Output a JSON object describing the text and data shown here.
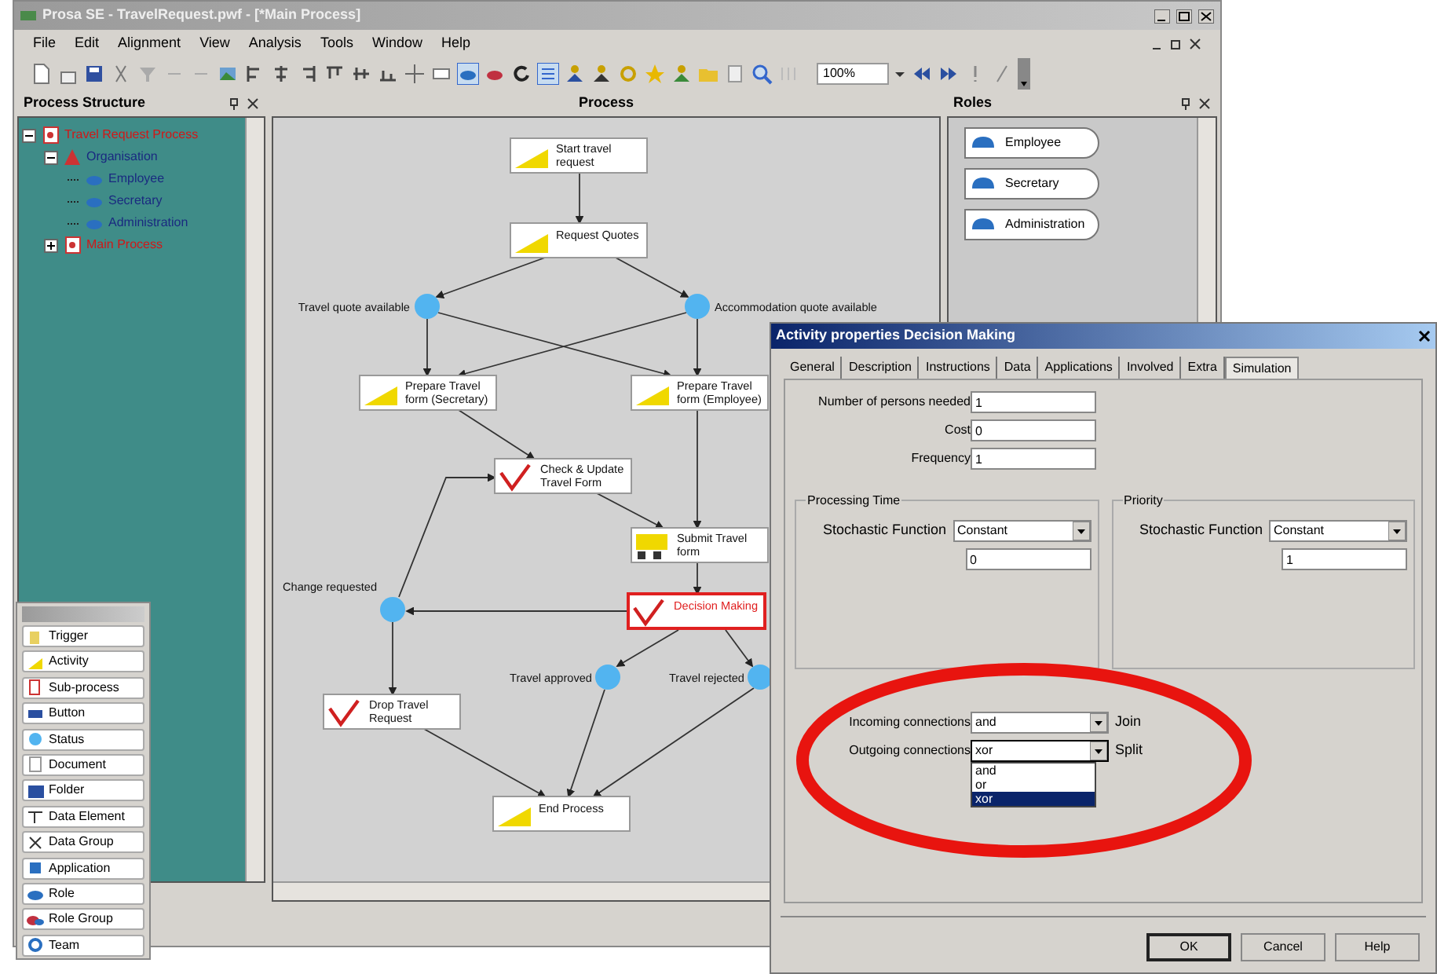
{
  "window": {
    "title": "Prosa SE - TravelRequest.pwf - [*Main Process]"
  },
  "menu": [
    "File",
    "Edit",
    "Alignment",
    "View",
    "Analysis",
    "Tools",
    "Window",
    "Help"
  ],
  "toolbar": {
    "zoom": "100%"
  },
  "structure": {
    "title": "Process Structure",
    "tree": [
      {
        "label": "Travel Request Process",
        "kind": "process",
        "expanded": true,
        "children": [
          {
            "label": "Organisation",
            "kind": "organisation",
            "expanded": true,
            "children": [
              {
                "label": "Employee",
                "kind": "role"
              },
              {
                "label": "Secretary",
                "kind": "role"
              },
              {
                "label": "Administration",
                "kind": "role"
              }
            ]
          },
          {
            "label": "Main Process",
            "kind": "process",
            "expanded": false
          }
        ]
      }
    ]
  },
  "process": {
    "title": "Process",
    "activities": [
      {
        "lines": [
          "Start travel",
          "request"
        ],
        "kind": "activity",
        "selected": false
      },
      {
        "lines": [
          "Request Quotes"
        ],
        "kind": "activity",
        "selected": false
      },
      {
        "lines": [
          "Prepare Travel",
          "form (Secretary)"
        ],
        "kind": "activity",
        "selected": false
      },
      {
        "lines": [
          "Prepare Travel",
          "form (Employee)"
        ],
        "kind": "activity",
        "selected": false
      },
      {
        "lines": [
          "Check & Update",
          "Travel Form"
        ],
        "kind": "check",
        "selected": false
      },
      {
        "lines": [
          "Submit Travel",
          "form"
        ],
        "kind": "submit",
        "selected": false
      },
      {
        "lines": [
          "Decision Making"
        ],
        "kind": "check",
        "selected": true
      },
      {
        "lines": [
          "Drop Travel",
          "Request"
        ],
        "kind": "check",
        "selected": false
      },
      {
        "lines": [
          "End Process"
        ],
        "kind": "activity",
        "selected": false
      }
    ],
    "gateways": [
      {
        "label": "Travel quote available"
      },
      {
        "label": "Accommodation quote available"
      },
      {
        "label": "Change requested"
      },
      {
        "label": "Travel approved"
      },
      {
        "label": "Travel rejected"
      }
    ]
  },
  "roles": {
    "title": "Roles",
    "items": [
      "Employee",
      "Secretary",
      "Administration"
    ]
  },
  "toolbox": [
    {
      "label": "Trigger",
      "kind": "trigger"
    },
    {
      "label": "Activity",
      "kind": "activity"
    },
    {
      "label": "Sub-process",
      "kind": "subprocess"
    },
    {
      "label": "Button",
      "kind": "button"
    },
    {
      "label": "Status",
      "kind": "status"
    },
    {
      "label": "Document",
      "kind": "document"
    },
    {
      "label": "Folder",
      "kind": "folder"
    },
    {
      "label": "Data Element",
      "kind": "element"
    },
    {
      "label": "Data Group",
      "kind": "group"
    },
    {
      "label": "Application",
      "kind": "application"
    },
    {
      "label": "Role",
      "kind": "role"
    },
    {
      "label": "Role Group",
      "kind": "rolegroup"
    },
    {
      "label": "Team",
      "kind": "team"
    }
  ],
  "dialog": {
    "title": "Activity properties Decision Making",
    "tabs": [
      {
        "label": "General",
        "selected": false
      },
      {
        "label": "Description",
        "selected": false
      },
      {
        "label": "Instructions",
        "selected": false
      },
      {
        "label": "Data",
        "selected": false
      },
      {
        "label": "Applications",
        "selected": false
      },
      {
        "label": "Involved",
        "selected": false
      },
      {
        "label": "Extra",
        "selected": false
      },
      {
        "label": "Simulation",
        "selected": true
      }
    ],
    "fields": [
      {
        "label": "Number of persons needed",
        "value": "1"
      },
      {
        "label": "Cost",
        "value": "0"
      },
      {
        "label": "Frequency",
        "value": "1"
      }
    ],
    "groups": [
      {
        "title": "Processing Time",
        "function_label": "Stochastic Function",
        "function": "Constant",
        "value": "0"
      },
      {
        "title": "Priority",
        "function_label": "Stochastic Function",
        "function": "Constant",
        "value": "1"
      }
    ],
    "connections": [
      {
        "label": "Incoming connections",
        "value": "and",
        "suffix": "Join"
      },
      {
        "label": "Outgoing connections",
        "value": "xor",
        "suffix": "Split",
        "open": true,
        "options": [
          {
            "label": "and",
            "selected": false
          },
          {
            "label": "or",
            "selected": false
          },
          {
            "label": "xor",
            "selected": true
          }
        ]
      }
    ],
    "buttons": [
      {
        "label": "OK",
        "default": true
      },
      {
        "label": "Cancel",
        "default": false
      },
      {
        "label": "Help",
        "default": false
      }
    ]
  }
}
